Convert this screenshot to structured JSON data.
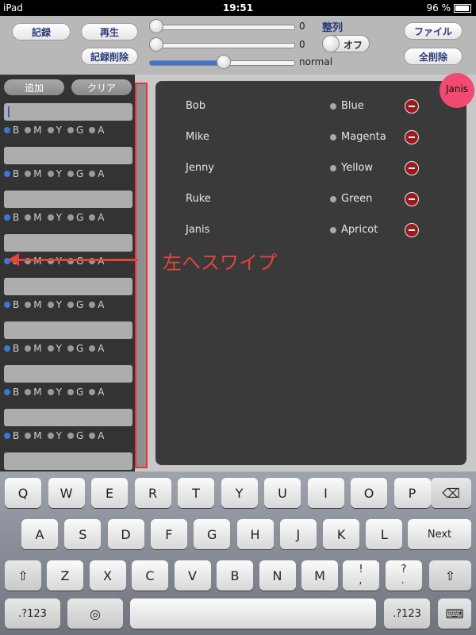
{
  "status": {
    "device": "iPad",
    "time": "19:51",
    "battery": "96 %"
  },
  "toolbar": {
    "record": "記録",
    "play": "再生",
    "delete_record": "記録削除",
    "slider1_value": "0",
    "slider2_value": "0",
    "slider3_value": "normal",
    "sort_label": "整列",
    "sort_toggle": "オフ",
    "file": "ファイル",
    "delete_all": "全削除"
  },
  "left": {
    "add": "追加",
    "clear": "クリア",
    "radio_labels": [
      "B",
      "M",
      "Y",
      "G",
      "A"
    ]
  },
  "list": [
    {
      "name": "Bob",
      "color": "Blue"
    },
    {
      "name": "Mike",
      "color": "Magenta"
    },
    {
      "name": "Jenny",
      "color": "Yellow"
    },
    {
      "name": "Ruke",
      "color": "Green"
    },
    {
      "name": "Janis",
      "color": "Apricot"
    }
  ],
  "bubble": "Janis",
  "annotation": "左へスワイプ",
  "keyboard": {
    "row1": [
      "Q",
      "W",
      "E",
      "R",
      "T",
      "Y",
      "U",
      "I",
      "O",
      "P"
    ],
    "row2": [
      "A",
      "S",
      "D",
      "F",
      "G",
      "H",
      "J",
      "K",
      "L"
    ],
    "next": "Next",
    "row3": [
      "Z",
      "X",
      "C",
      "V",
      "B",
      "N",
      "M"
    ],
    "punct1": "!\n,",
    "punct2": "?\n.",
    "num": ".?123"
  },
  "colors": {
    "accent": "#3b76d9",
    "annotation": "#e6433a",
    "delete": "#9a1b1b",
    "bubble": "#f24a70"
  }
}
